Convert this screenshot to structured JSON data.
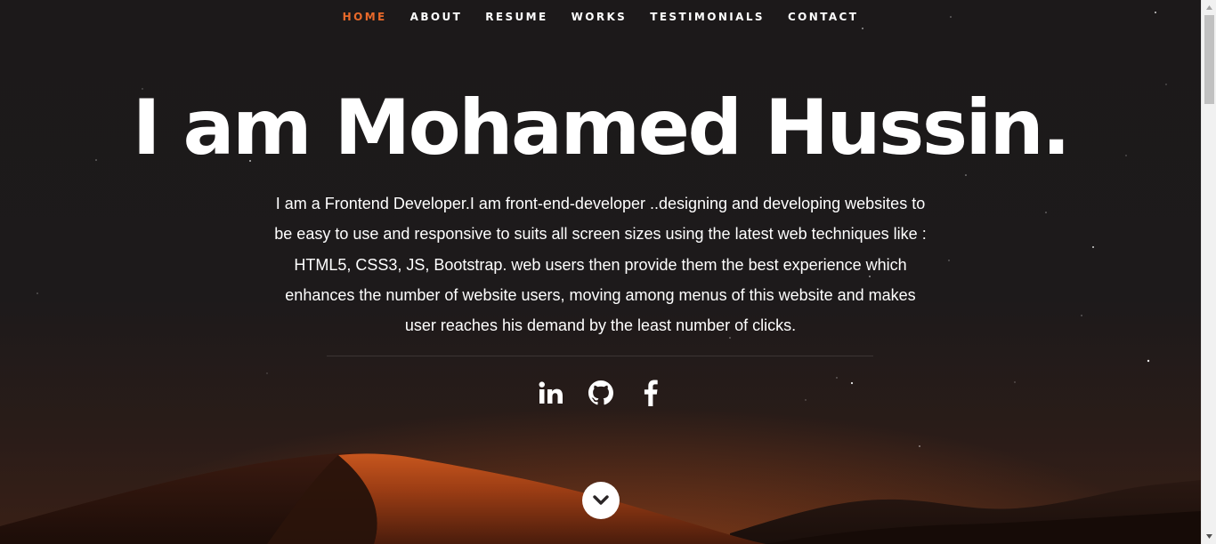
{
  "nav": {
    "items": [
      {
        "label": "HOME",
        "active": true
      },
      {
        "label": "ABOUT",
        "active": false
      },
      {
        "label": "RESUME",
        "active": false
      },
      {
        "label": "WORKS",
        "active": false
      },
      {
        "label": "TESTIMONIALS",
        "active": false
      },
      {
        "label": "CONTACT",
        "active": false
      }
    ],
    "active_color": "#e8692a"
  },
  "hero": {
    "headline": "I am Mohamed Hussin.",
    "intro": "I am a Frontend Developer.I am front-end-developer ..designing and developing websites to be easy to use and responsive to suits all screen sizes using the latest web techniques like : HTML5, CSS3, JS, Bootstrap. web users then provide them the best experience which enhances the number of website users, moving among menus of this website and makes user reaches his demand by the least number of clicks."
  },
  "social": [
    {
      "icon": "linkedin-icon"
    },
    {
      "icon": "github-icon"
    },
    {
      "icon": "facebook-icon"
    }
  ],
  "scroll_down": {
    "icon": "chevron-down-icon"
  },
  "colors": {
    "background": "#1c191a",
    "accent": "#e8692a",
    "text": "#ffffff"
  }
}
